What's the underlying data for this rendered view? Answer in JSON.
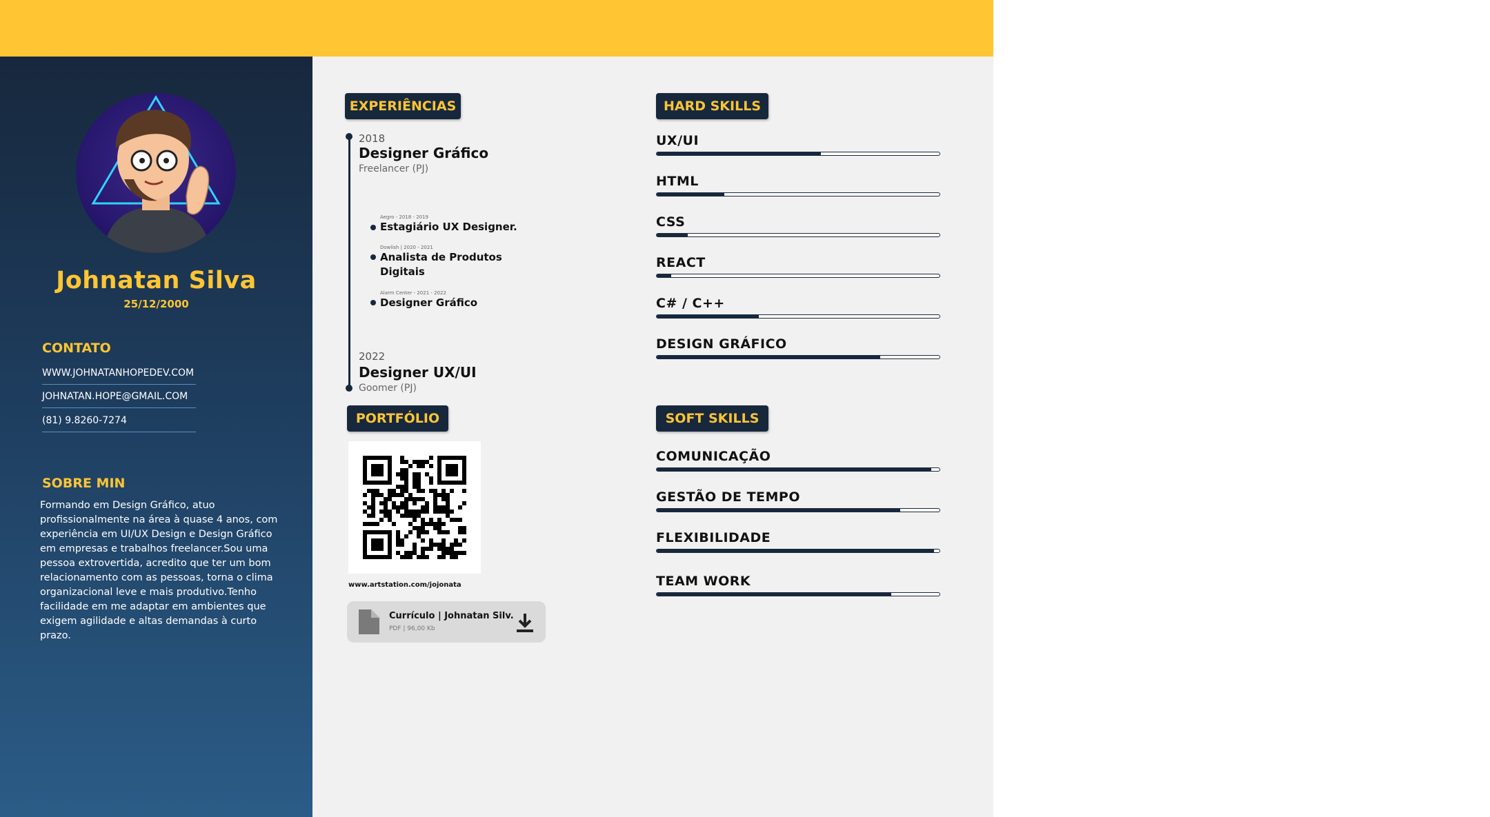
{
  "profile": {
    "name": "Johnatan Silva",
    "dob": "25/12/2000"
  },
  "contact": {
    "heading": "CONTATO",
    "website": "WWW.JOHNATANHOPEDEV.COM",
    "email": "JOHNATAN.HOPE@GMAIL.COM",
    "phone": "(81) 9.8260-7274"
  },
  "about": {
    "heading": "SOBRE MIN",
    "text": "Formando em Design Gráfico, atuo profissionalmente na área à quase 4 anos, com experiência em UI/UX Design e Design Gráfico em empresas e trabalhos freelancer.Sou uma pessoa extrovertida, acredito que ter um bom relacionamento com as pessoas, torna o clima organizacional leve e mais produtivo.Tenho facilidade em me adaptar em ambientes que exigem agilidade e altas demandas à curto prazo."
  },
  "experience": {
    "heading": "EXPERIÊNCIAS",
    "start": {
      "year": "2018",
      "role": "Designer Gráfico",
      "company": "Freelancer (PJ)"
    },
    "items": [
      {
        "meta": "Aegro - 2018 - 2019",
        "role": "Estagiário UX Designer."
      },
      {
        "meta": "Dowlish | 2020 - 2021",
        "role": "Analista de Produtos Digitais"
      },
      {
        "meta": "Alarm Center - 2021 - 2022",
        "role": "Designer Gráfico"
      }
    ],
    "end": {
      "year": "2022",
      "role": "Designer UX/UI",
      "company": "Goomer (PJ)"
    }
  },
  "portfolio": {
    "heading": "PORTFÓLIO",
    "url": "www.artstation.com/jojonata",
    "file": {
      "title": "Currículo | Johnatan Silv.",
      "meta": "PDF | 96,00 Kb",
      "icon": "file-icon",
      "download_icon": "download-icon"
    }
  },
  "hard_skills": {
    "heading": "HARD SKILLS",
    "items": [
      {
        "label": "UX/UI",
        "level": 0.58
      },
      {
        "label": "HTML",
        "level": 0.24
      },
      {
        "label": "CSS",
        "level": 0.11
      },
      {
        "label": "REACT",
        "level": 0.05
      },
      {
        "label": "C# / C++",
        "level": 0.36
      },
      {
        "label": "DESIGN GRÁFICO",
        "level": 0.79
      }
    ]
  },
  "soft_skills": {
    "heading": "SOFT SKILLS",
    "items": [
      {
        "label": "COMUNICAÇÃO",
        "level": 0.97
      },
      {
        "label": "GESTÃO DE TEMPO",
        "level": 0.86
      },
      {
        "label": "FLEXIBILIDADE",
        "level": 0.98
      },
      {
        "label": "TEAM WORK",
        "level": 0.83
      }
    ]
  },
  "colors": {
    "accent": "#ffc533",
    "navy": "#17283d",
    "background": "#f1f1f1"
  }
}
